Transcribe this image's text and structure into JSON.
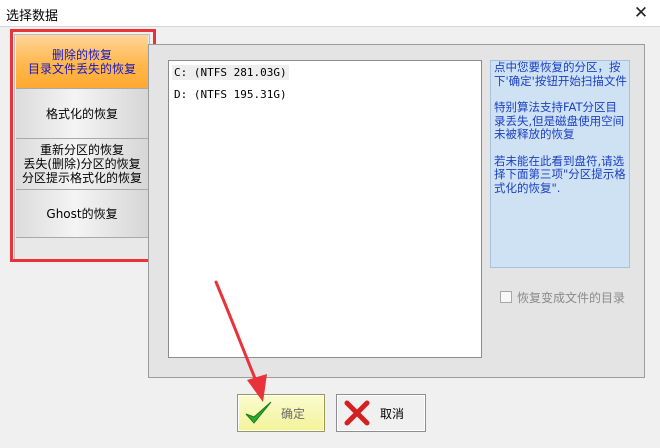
{
  "window": {
    "title": "选择数据",
    "close_glyph": "✕"
  },
  "tabs": [
    {
      "lines": [
        "删除的恢复",
        "目录文件丢失的恢复"
      ],
      "active": true
    },
    {
      "lines": [
        "格式化的恢复"
      ],
      "active": false
    },
    {
      "lines": [
        "重新分区的恢复",
        "丢失(删除)分区的恢复",
        "分区提示格式化的恢复"
      ],
      "active": false
    },
    {
      "lines": [
        "Ghost的恢复"
      ],
      "active": false
    }
  ],
  "drives": [
    {
      "label": "C:  (NTFS 281.03G)",
      "selected": true
    },
    {
      "label": "D:  (NTFS 195.31G)",
      "selected": false
    }
  ],
  "info": {
    "paragraphs": [
      "点中您要恢复的分区，按下'确定'按钮开始扫描文件",
      "特别算法支持FAT分区目录丢失,但是磁盘使用空间未被释放的恢复",
      "若未能在此看到盘符,请选择下面第三项\"分区提示格式化的恢复\"."
    ]
  },
  "checkbox": {
    "label": "恢复变成文件的目录",
    "checked": false
  },
  "buttons": {
    "ok_label": "确定",
    "cancel_label": "取消"
  },
  "colors": {
    "highlight_red": "#e8333b",
    "active_tab_orange": "#ffb84c",
    "info_blue_text": "#1a3fc4",
    "info_bg": "#cfe2f3",
    "ok_check_green": "#2eaa2e",
    "cancel_x_red": "#d42020"
  },
  "icons": {
    "ok": "check-icon",
    "cancel": "x-mark-icon",
    "close": "close-icon"
  }
}
